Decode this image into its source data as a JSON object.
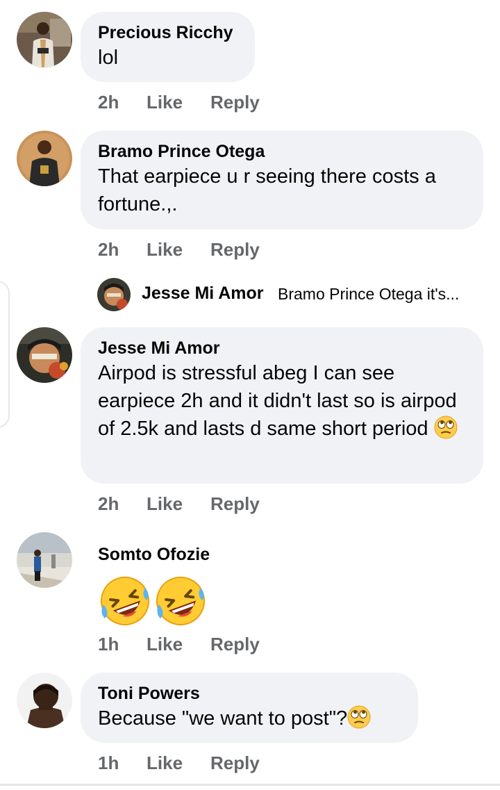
{
  "comments": [
    {
      "name": "Precious Ricchy",
      "text": "lol",
      "time": "2h",
      "like": "Like",
      "reply": "Reply",
      "avatar_icon": "profile-photo"
    },
    {
      "name": "Bramo Prince Otega",
      "text": "That earpiece u r seeing there costs a fortune.,.",
      "time": "2h",
      "like": "Like",
      "reply": "Reply",
      "avatar_icon": "profile-photo"
    },
    {
      "name": "Jesse Mi Amor",
      "text": "Airpod is stressful abeg I can see earpiece 2h and it didn't last so is airpod of 2.5k and lasts d same short period",
      "emoji": "face-with-rolling-eyes",
      "time": "2h",
      "like": "Like",
      "reply": "Reply",
      "avatar_icon": "profile-photo"
    },
    {
      "name": "Somto Ofozie",
      "emojis": [
        "rolling-on-the-floor-laughing",
        "rolling-on-the-floor-laughing"
      ],
      "time": "1h",
      "like": "Like",
      "reply": "Reply",
      "avatar_icon": "profile-photo"
    },
    {
      "name": "Toni Powers",
      "text": "Because \"we want to post\"?",
      "emoji": "face-with-rolling-eyes",
      "time": "1h",
      "like": "Like",
      "reply": "Reply",
      "avatar_icon": "profile-photo"
    }
  ],
  "reply_preview": {
    "name": "Jesse Mi Amor",
    "text": "Bramo Prince Otega it's..."
  },
  "colors": {
    "bubble": "#f0f2f5",
    "action_text": "#65676b",
    "name_text": "#050505"
  }
}
